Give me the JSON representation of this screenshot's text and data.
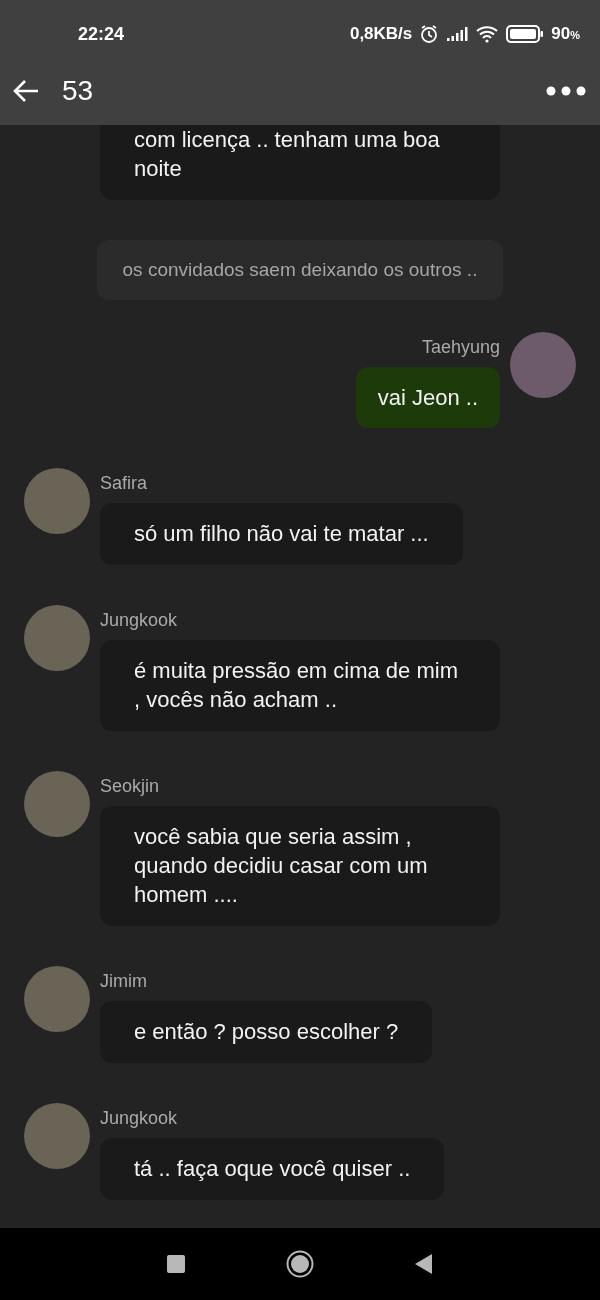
{
  "status_bar": {
    "time": "22:24",
    "speed": "0,8KB/s",
    "battery": "90",
    "battery_unit": "%"
  },
  "app_bar": {
    "title": "53"
  },
  "messages": [
    {
      "kind": "incoming",
      "text": "com licença .. tenham uma boa noite"
    },
    {
      "kind": "system",
      "text": "os convidados saem deixando os outros .."
    },
    {
      "kind": "outgoing",
      "author": "Taehyung",
      "text": "vai Jeon .."
    },
    {
      "kind": "incoming",
      "author": "Safira",
      "text": "só um filho não vai te matar ..."
    },
    {
      "kind": "incoming",
      "author": "Jungkook",
      "text": "é muita pressão em cima de mim , vocês não acham .."
    },
    {
      "kind": "incoming",
      "author": "Seokjin",
      "text": "você sabia que seria assim , quando decidiu casar com um homem ...."
    },
    {
      "kind": "incoming",
      "author": "Jimim",
      "text": "e então ? posso escolher ?"
    },
    {
      "kind": "incoming",
      "author": "Jungkook",
      "text": "tá .. faça oque você quiser .."
    }
  ]
}
